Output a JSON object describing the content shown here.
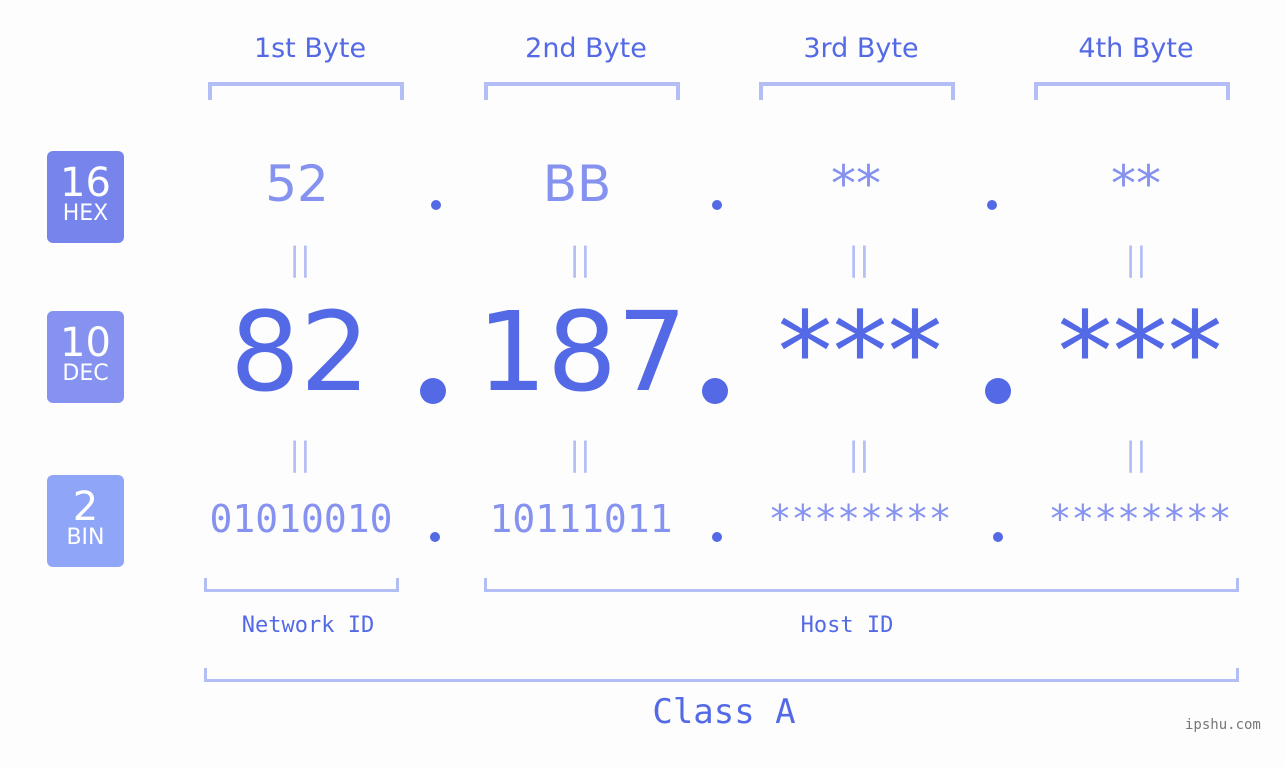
{
  "bytes": [
    {
      "header": "1st Byte",
      "hex": "52",
      "dec": "82",
      "bin": "01010010"
    },
    {
      "header": "2nd Byte",
      "hex": "BB",
      "dec": "187",
      "bin": "10111011"
    },
    {
      "header": "3rd Byte",
      "hex": "**",
      "dec": "***",
      "bin": "********"
    },
    {
      "header": "4th Byte",
      "hex": "**",
      "dec": "***",
      "bin": "********"
    }
  ],
  "badges": {
    "hex": {
      "num": "16",
      "label": "HEX",
      "color": "#7684ec"
    },
    "dec": {
      "num": "10",
      "label": "DEC",
      "color": "#8592ef"
    },
    "bin": {
      "num": "2",
      "label": "BIN",
      "color": "#8fa5f7"
    }
  },
  "equals_symbol": "||",
  "labels": {
    "network_id": "Network ID",
    "host_id": "Host ID",
    "class": "Class A"
  },
  "watermark": "ipshu.com",
  "colors": {
    "accent": "#5469e6",
    "light": "#8592ef",
    "bracket": "#b3bdf6"
  }
}
